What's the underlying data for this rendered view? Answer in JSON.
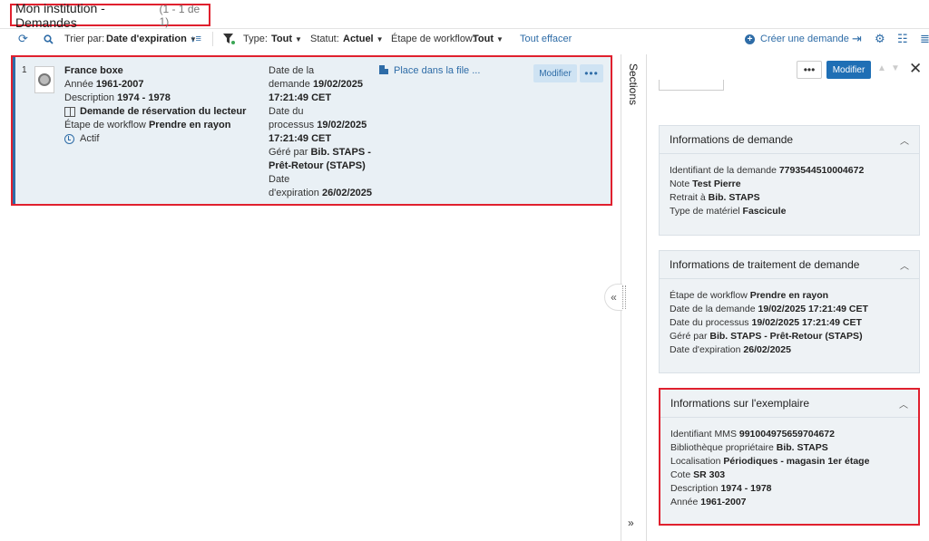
{
  "header": {
    "title": "Mon institution -Demandes",
    "count": "(1 - 1 de 1)"
  },
  "toolbar": {
    "sort_label": "Trier par:",
    "sort_value": "Date d'expiration",
    "type_label": "Type:",
    "type_value": "Tout",
    "status_label": "Statut:",
    "status_value": "Actuel",
    "workflow_label": "Étape de workflow:",
    "workflow_value": "Tout",
    "clear_all": "Tout effacer",
    "create_request": "Créer une demande"
  },
  "result": {
    "index": "1",
    "title": "France boxe",
    "year_label": "Année",
    "year_value": "1961-2007",
    "description_label": "Description",
    "description_value": "1974 - 1978",
    "request_type": "Demande de réservation du lecteur",
    "workflow_label": "Étape de workflow",
    "workflow_value": "Prendre en rayon",
    "status": "Actif",
    "request_date_label_1": "Date de la",
    "request_date_label_2": "demande",
    "request_date_value_1": "19/02/2025",
    "request_date_value_2": "17:21:49 CET",
    "process_date_label_1": "Date du",
    "process_date_label_2": "processus",
    "process_date_value_1": "19/02/2025",
    "process_date_value_2": "17:21:49 CET",
    "managed_label": "Géré par",
    "managed_value_1": "Bib. STAPS -",
    "managed_value_2": "Prêt-Retour (STAPS)",
    "expiry_label_1": "Date",
    "expiry_label_2": "d'expiration",
    "expiry_value": "26/02/2025",
    "queue_link": "Place dans la file ...",
    "modify_button": "Modifier",
    "more_button": "•••"
  },
  "side": {
    "sections_tab": "Sections",
    "collapse": "«",
    "expand": "»"
  },
  "panel": {
    "more_button": "•••",
    "modify_button": "Modifier",
    "up": "▲",
    "down": "▼",
    "close": "✕",
    "card1": {
      "title": "Informations de demande",
      "id_label": "Identifiant de la demande",
      "id_value": "7793544510004672",
      "note_label": "Note",
      "note_value": "Test Pierre",
      "pickup_label": "Retrait à",
      "pickup_value": "Bib. STAPS",
      "material_label": "Type de matériel",
      "material_value": "Fascicule"
    },
    "card2": {
      "title": "Informations de traitement de demande",
      "workflow_label": "Étape de workflow",
      "workflow_value": "Prendre en rayon",
      "request_date_label": "Date de la demande",
      "request_date_value": "19/02/2025 17:21:49 CET",
      "process_date_label": "Date du processus",
      "process_date_value": "19/02/2025 17:21:49 CET",
      "managed_label": "Géré par",
      "managed_value": "Bib. STAPS - Prêt-Retour (STAPS)",
      "expiry_label": "Date d'expiration",
      "expiry_value": "26/02/2025"
    },
    "card3": {
      "title": "Informations sur l'exemplaire",
      "mms_label": "Identifiant MMS",
      "mms_value": "991004975659704672",
      "library_label": "Bibliothèque propriétaire",
      "library_value": "Bib. STAPS",
      "location_label": "Localisation",
      "location_value": "Périodiques - magasin 1er étage",
      "callno_label": "Cote",
      "callno_value": "SR 303",
      "description_label": "Description",
      "description_value": "1974 - 1978",
      "year_label": "Année",
      "year_value": "1961-2007"
    }
  },
  "colors": {
    "accent": "#2e6ca7",
    "primary_button": "#1f6fb5",
    "highlight": "#e0202e",
    "row_bg": "#e9f0f5",
    "card_bg": "#eef2f5"
  }
}
